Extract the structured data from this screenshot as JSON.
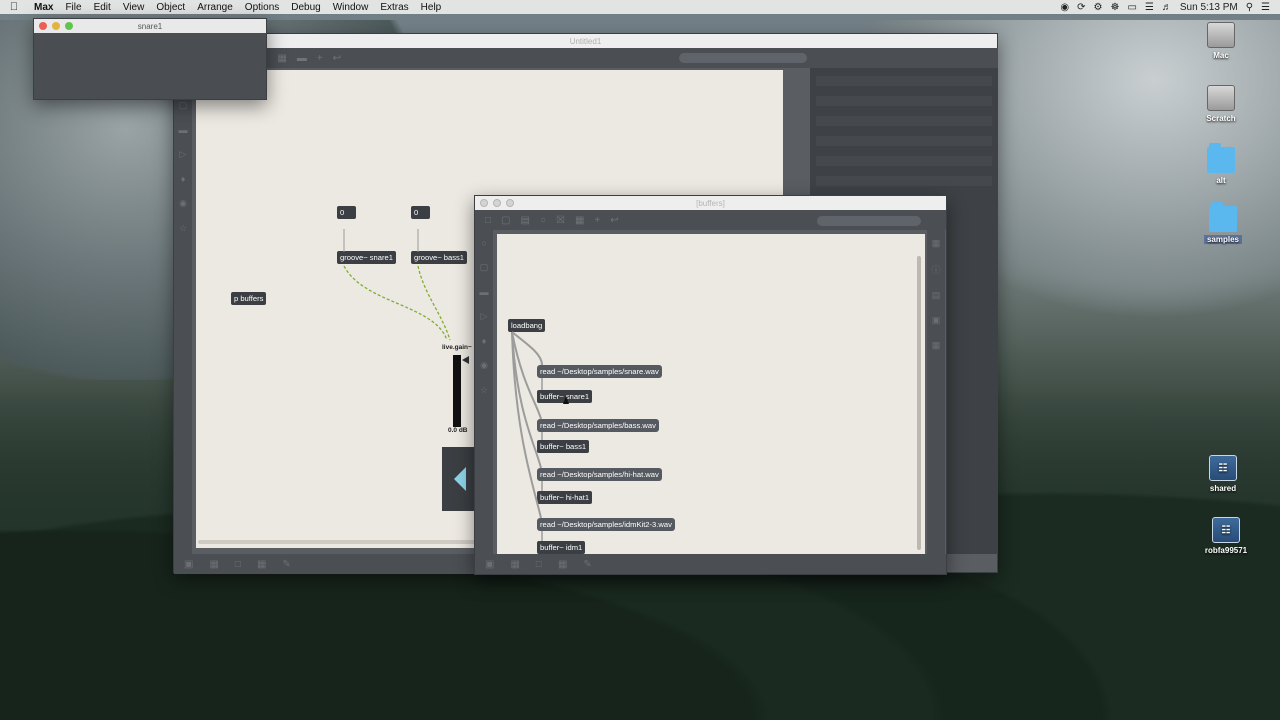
{
  "menubar": {
    "apple": "",
    "items": [
      "Max",
      "File",
      "Edit",
      "View",
      "Object",
      "Arrange",
      "Options",
      "Debug",
      "Window",
      "Extras",
      "Help"
    ],
    "clock": "Sun 5:13 PM"
  },
  "windows": {
    "snare": {
      "title": "snare1"
    },
    "main": {
      "title": "Untitled1"
    },
    "buffers": {
      "title": "[buffers]"
    }
  },
  "main_patch": {
    "num1": "0",
    "num2": "0",
    "groove_snare": "groove~ snare1",
    "groove_bass": "groove~ bass1",
    "p_buffers": "p buffers",
    "live_gain": "live.gain~",
    "gain_value": "0.0 dB"
  },
  "buffers_patch": {
    "loadbang": "loadbang",
    "read_snare": "read ~/Desktop/samples/snare.wav",
    "buffer_snare": "buffer~ snare1",
    "read_bass": "read ~/Desktop/samples/bass.wav",
    "buffer_bass": "buffer~ bass1",
    "read_hihat": "read ~/Desktop/samples/hi-hat.wav",
    "buffer_hihat": "buffer~ hi-hat1",
    "read_idm": "read ~/Desktop/samples/idmKit2-3.wav",
    "buffer_idm": "buffer~ idm1"
  },
  "desktop_icons": {
    "mac": "Mac",
    "scratch": "Scratch",
    "alt": "alt",
    "samples": "samples",
    "shared": "shared",
    "robfa": "robfa99571"
  },
  "colors": {
    "object_bg": "#3b3e42",
    "canvas": "#ece9e2",
    "patch_cord_signal": "#8fbf3a"
  }
}
